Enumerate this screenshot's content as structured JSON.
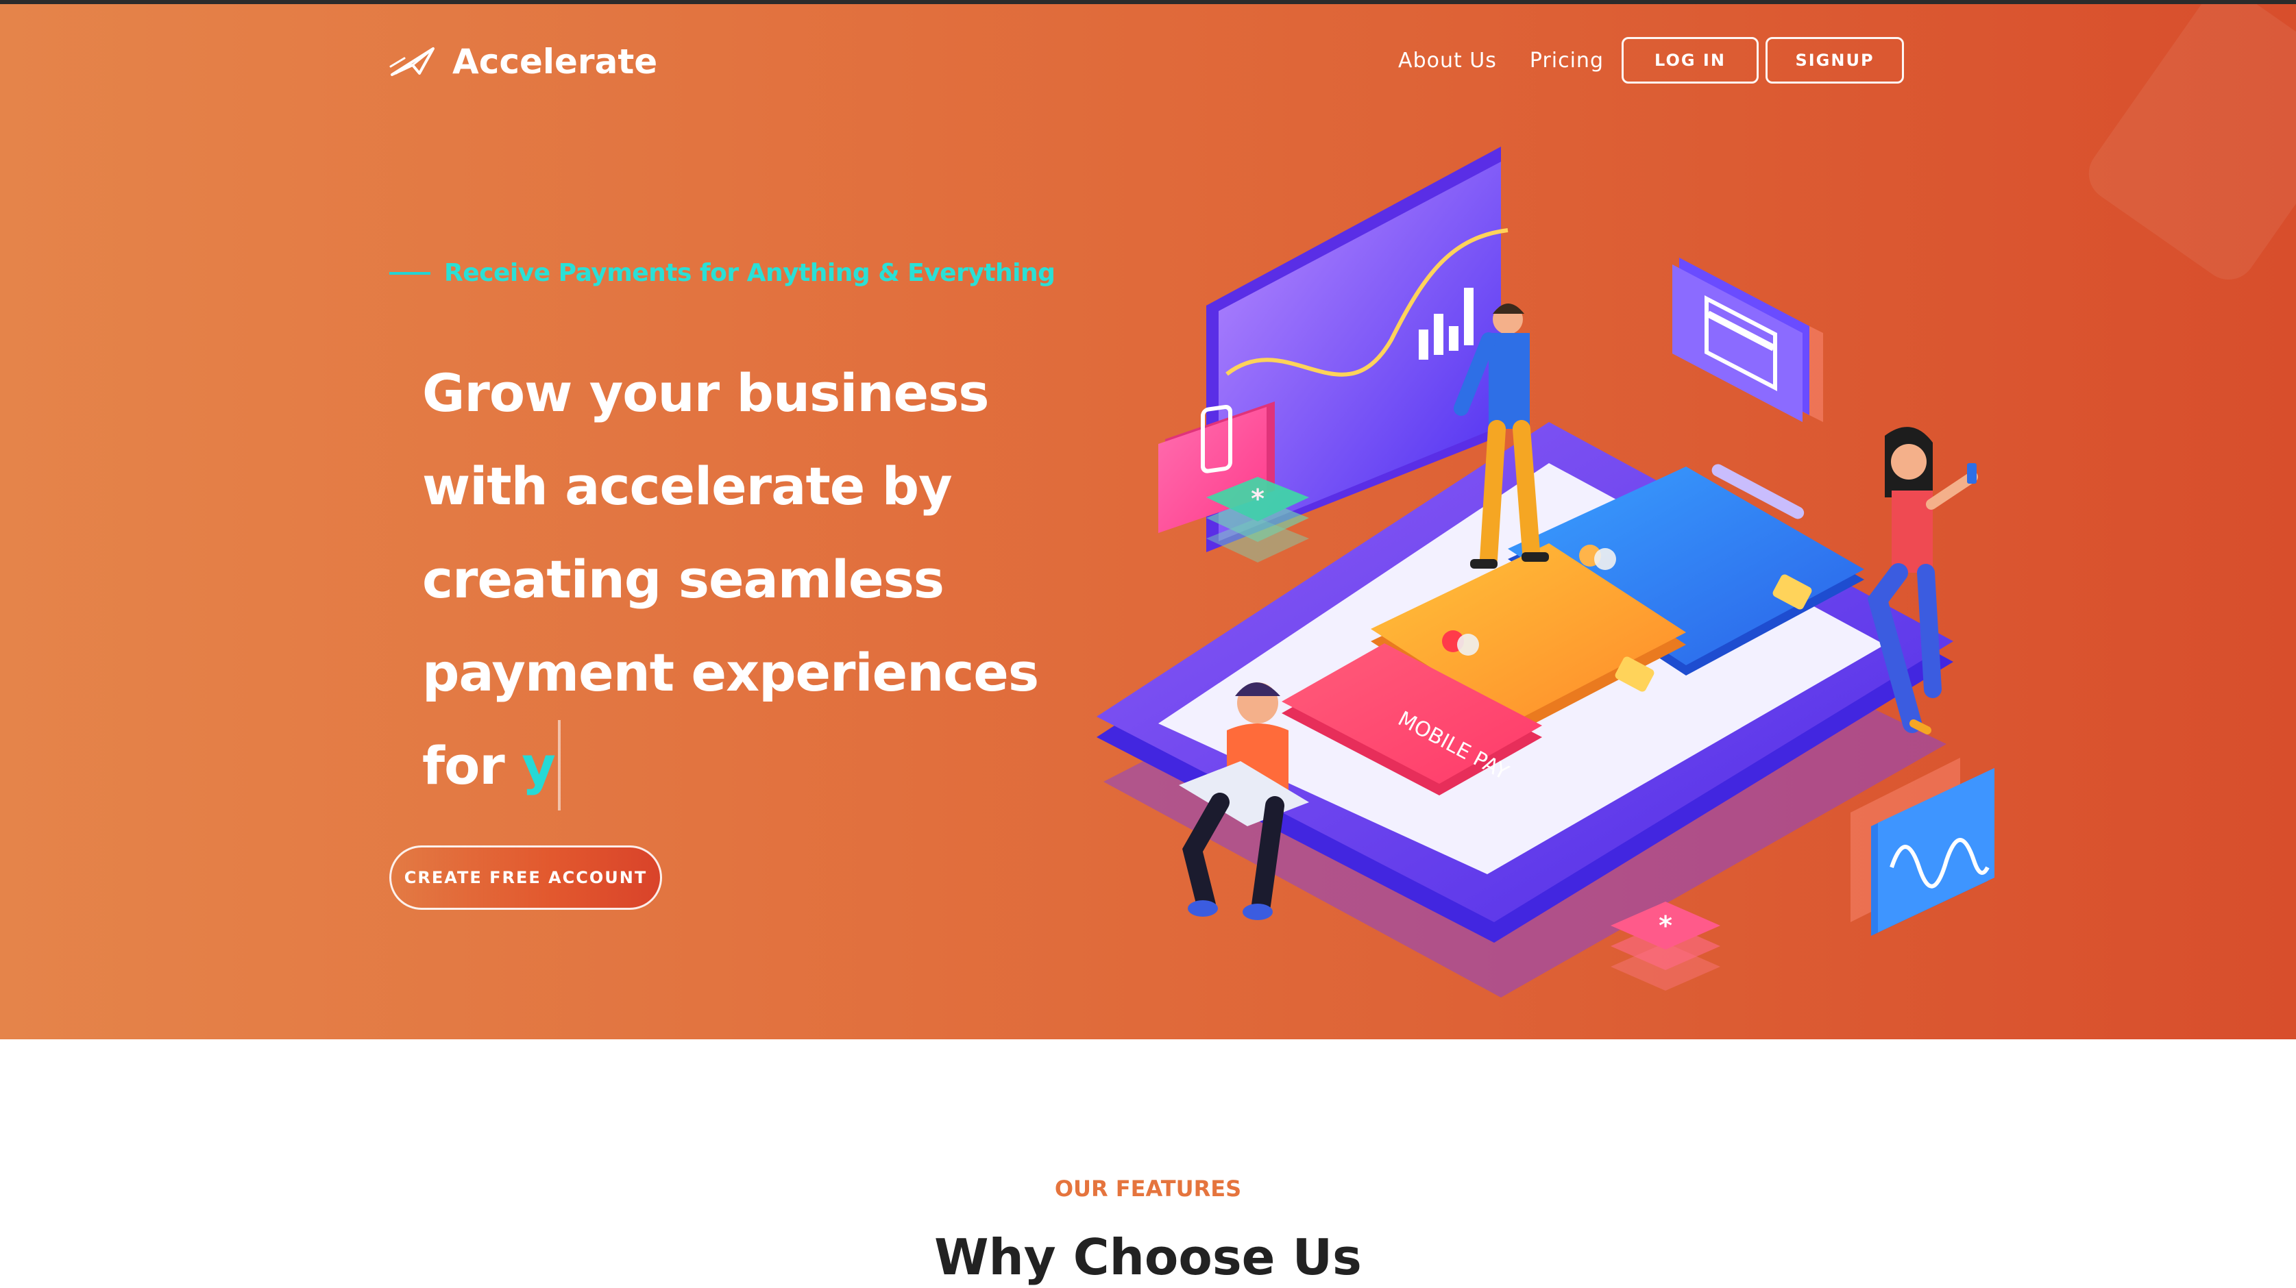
{
  "header": {
    "brand": "Accelerate",
    "nav_links": [
      "About Us",
      "Pricing"
    ],
    "login_label": "LOG IN",
    "signup_label": "SIGNUP"
  },
  "hero": {
    "tagline": "Receive Payments for Anything & Everything",
    "headline_lines": [
      "Grow your business",
      "with accelerate by",
      "creating seamless",
      "payment experiences"
    ],
    "headline_last_prefix": "for",
    "headline_typed": "y",
    "cta_label": "CREATE FREE ACCOUNT",
    "illustration_card_label": "MOBILE PAY"
  },
  "features": {
    "eyebrow": "OUR FEATURES",
    "title": "Why Choose Us"
  },
  "colors": {
    "hero_start": "#e5844a",
    "hero_end": "#d84e2c",
    "accent_teal": "#2ae0d6",
    "features_eyebrow": "#e5743d"
  },
  "icons": {
    "logo": "paper-plane-icon"
  }
}
